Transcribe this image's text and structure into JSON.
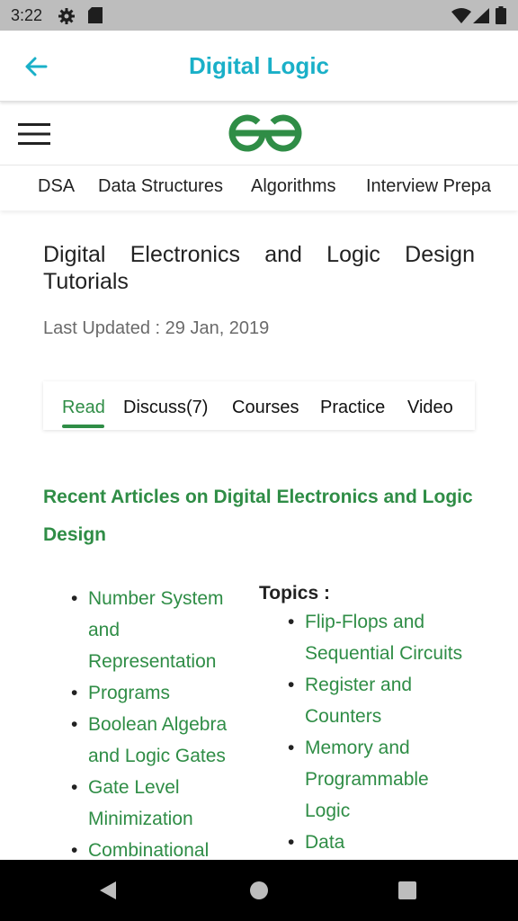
{
  "status_bar": {
    "time": "3:22",
    "icons": [
      "gear-icon",
      "sd-card-icon",
      "wifi-icon",
      "signal-icon",
      "battery-icon"
    ]
  },
  "app_bar": {
    "title": "Digital Logic",
    "back_icon": "arrow-back-icon"
  },
  "site_header": {
    "menu_icon": "hamburger-menu-icon",
    "logo_icon": "gfg-logo-icon"
  },
  "nav": {
    "items": [
      "DSA",
      "Data Structures",
      "Algorithms",
      "Interview Prepa"
    ]
  },
  "article": {
    "title_line1": "Digital Electronics and Logic Design",
    "title_line2": "Tutorials",
    "last_updated": "Last Updated : 29 Jan, 2019"
  },
  "tabs": {
    "items": [
      "Read",
      "Discuss(7)",
      "Courses",
      "Practice",
      "Video"
    ],
    "active": "Read"
  },
  "section": {
    "heading": "Recent Articles on Digital Electronics and Logic Design"
  },
  "left_list": {
    "items": [
      "Number System and Representation",
      "Programs",
      "Boolean Algebra and Logic Gates",
      "Gate Level Minimization",
      "Combinational"
    ]
  },
  "topics": {
    "label": "Topics :",
    "items": [
      "Flip-Flops and Sequential Circuits",
      "Register and Counters",
      "Memory and Programmable Logic",
      "Data Communication"
    ]
  },
  "colors": {
    "accent": "#1ab0c8",
    "brand_green": "#2f8d46",
    "status_bar": "#bdbdbd"
  },
  "system_nav": {
    "icons": [
      "back-triangle-icon",
      "home-circle-icon",
      "recents-square-icon"
    ]
  }
}
